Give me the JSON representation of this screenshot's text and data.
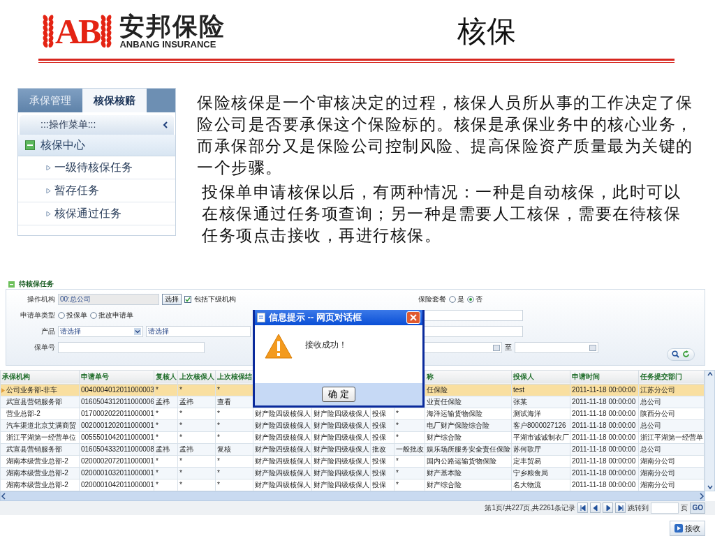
{
  "slide": {
    "title": "核保"
  },
  "logo": {
    "mark": "AB",
    "name": "安邦保险",
    "subtitle": "ANBANG INSURANCE"
  },
  "nav_panel": {
    "tabs": [
      {
        "label": "承保管理",
        "selected": false
      },
      {
        "label": "核保核赔",
        "selected": true
      }
    ],
    "menu_title": ":::操作菜单:::",
    "group": {
      "label": "核保中心",
      "expanded": true,
      "children": [
        {
          "label": "一级待核保任务"
        },
        {
          "label": "暂存任务"
        },
        {
          "label": "核保通过任务"
        }
      ]
    }
  },
  "paragraphs": [
    "保险核保是一个审核决定的过程，核保人员所从事的工作决定了保险公司是否要承保这个保险标的。核保是承保业务中的核心业务，而承保部分又是保险公司控制风险、提高保险资产质量最为关键的一个步骤。",
    "投保单申请核保以后，有两种情况：一种是自动核保，此时可以在核保通过任务项查询；另一种是需要人工核保，需要在待核保任务项点击接收，再进行核保。"
  ],
  "app": {
    "section_title": "待核保任务",
    "filters": {
      "org": {
        "label": "操作机构",
        "value": "00:总公司",
        "button": "选择",
        "include_sub": {
          "label": "包括下级机构",
          "checked": true
        }
      },
      "form_type": {
        "label": "申请单类型",
        "options": [
          {
            "label": "投保单",
            "selected": false
          },
          {
            "label": "批改申请单",
            "selected": false
          }
        ]
      },
      "product": {
        "label": "产品",
        "value": "请选择",
        "value_2": "请选择"
      },
      "policy_no": {
        "label": "保单号"
      },
      "package": {
        "label": "保险套餐",
        "options": [
          {
            "label": "是",
            "selected": false
          },
          {
            "label": "否",
            "selected": true
          }
        ]
      },
      "date_range": {
        "separator": "至"
      }
    },
    "table": {
      "columns": [
        "承保机构",
        "申请单号",
        "复核人",
        "上次核保人",
        "上次核保结",
        null,
        null,
        null,
        null,
        "称",
        "投保人",
        "申请时间",
        "任务提交部门"
      ],
      "rows": [
        {
          "selected": true,
          "cells": [
            "公司业务部-非车",
            "0040004012011000003",
            "*",
            "*",
            "*",
            null,
            null,
            null,
            null,
            "任保险",
            "test",
            "2011-11-18 00:00:00",
            "江苏分公司"
          ]
        },
        {
          "selected": false,
          "cells": [
            "武宣县营销服务部",
            "0160504312011000006",
            "孟祎",
            "孟祎",
            "查看",
            null,
            null,
            null,
            null,
            "业责任保险",
            "张某",
            "2011-11-18 00:00:00",
            "总公司"
          ]
        },
        {
          "selected": false,
          "cells": [
            "营业总部-2",
            "0170002022011000001",
            "*",
            "*",
            "*",
            "财产险四级核保人",
            "财产险四级核保人",
            "投保",
            "*",
            "海洋运输货物保险",
            "测试海洋",
            "2011-11-18 00:00:00",
            "陕西分公司"
          ]
        },
        {
          "selected": false,
          "cells": [
            "汽车渠道北京艾满商贸",
            "0020001202011000001",
            "*",
            "*",
            "*",
            "财产险四级核保人",
            "财产险四级核保人",
            "投保",
            "*",
            "电厂财产保险综合险",
            "客户8000027126",
            "2011-11-18 00:00:00",
            "总公司"
          ]
        },
        {
          "selected": false,
          "cells": [
            "浙江平湖第一经营单位",
            "0055501042011000001",
            "*",
            "*",
            "*",
            "财产险四级核保人",
            "财产险四级核保人",
            "投保",
            "*",
            "财产综合险",
            "平湖市诚诚制衣厂",
            "2011-11-18 00:00:00",
            "浙江平湖第一经营单"
          ]
        },
        {
          "selected": false,
          "cells": [
            "武宣县营销服务部",
            "0160504332011000008",
            "孟祎",
            "孟祎",
            "复核",
            "财产险四级核保人",
            "财产险四级核保人",
            "批改",
            "一般批改",
            "娱乐场所服务安全责任保险",
            "苏何歌厅",
            "2011-11-18 00:00:00",
            "总公司"
          ]
        },
        {
          "selected": false,
          "cells": [
            "湖南本级营业总部-2",
            "0200002072011000001",
            "*",
            "*",
            "*",
            "财产险四级核保人",
            "财产险四级核保人",
            "投保",
            "*",
            "国内公路运输货物保险",
            "定丰贸易",
            "2011-11-18 00:00:00",
            "湖南分公司"
          ]
        },
        {
          "selected": false,
          "cells": [
            "湖南本级营业总部-2",
            "0200001032011000001",
            "*",
            "*",
            "*",
            "财产险四级核保人",
            "财产险四级核保人",
            "投保",
            "*",
            "财产基本险",
            "宁乡粮食局",
            "2011-11-18 00:00:00",
            "湖南分公司"
          ]
        },
        {
          "selected": false,
          "cells": [
            "湖南本级营业总部-2",
            "0200001042011000001",
            "*",
            "*",
            "*",
            "财产险四级核保人",
            "财产险四级核保人",
            "投保",
            "*",
            "财产综合险",
            "名大物流",
            "2011-11-18 00:00:00",
            "湖南分公司"
          ]
        }
      ]
    },
    "pagination": {
      "summary": "第1页/共227页,共2261条记录",
      "jump_label": "跳转到",
      "page_unit": "页",
      "go": "GO"
    },
    "receive_button": "接收",
    "dialog": {
      "title": "信息提示 -- 网页对话框",
      "message": "接收成功！",
      "ok": "确 定"
    }
  }
}
